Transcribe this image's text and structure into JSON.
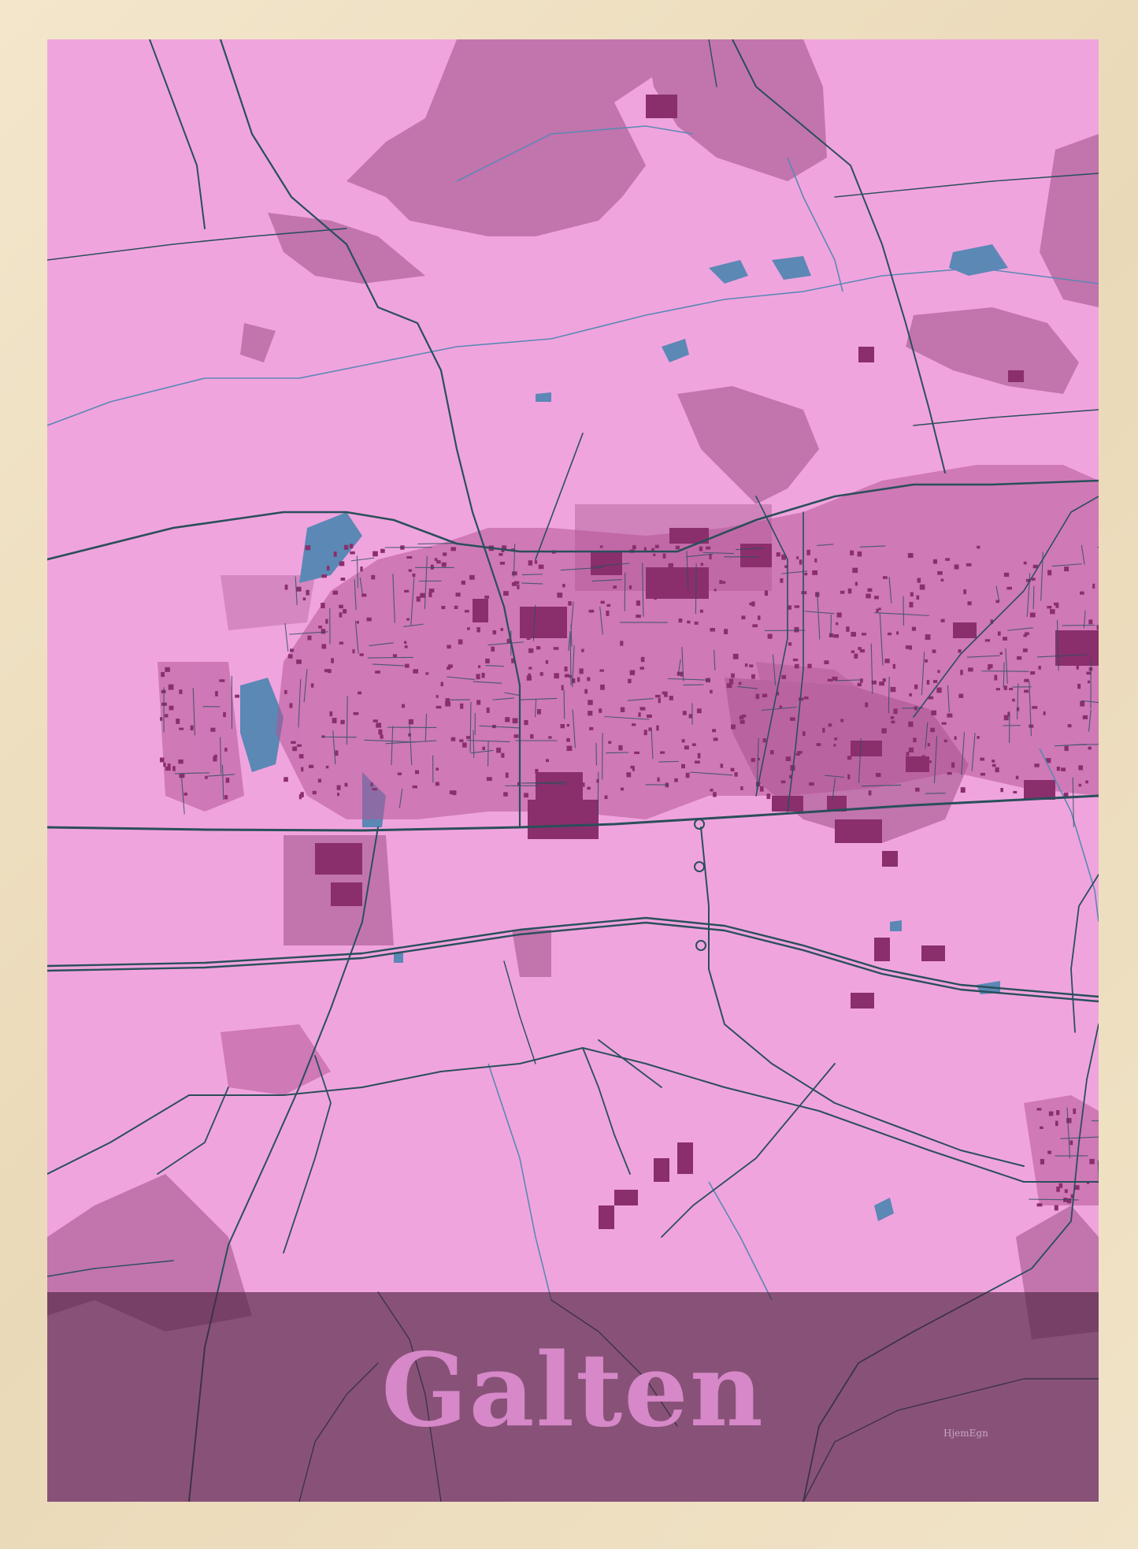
{
  "poster": {
    "city_name": "Galten",
    "brand_mark": "HjemEgn"
  },
  "colors": {
    "land": "#f0a4de",
    "forest": "#c274ad",
    "buildings": "#8a2f6c",
    "water": "#5b88b5",
    "roads": "#2a4f5a",
    "band": "#5a2a48",
    "title": "#d688c8",
    "frame": "#efe2c6"
  }
}
